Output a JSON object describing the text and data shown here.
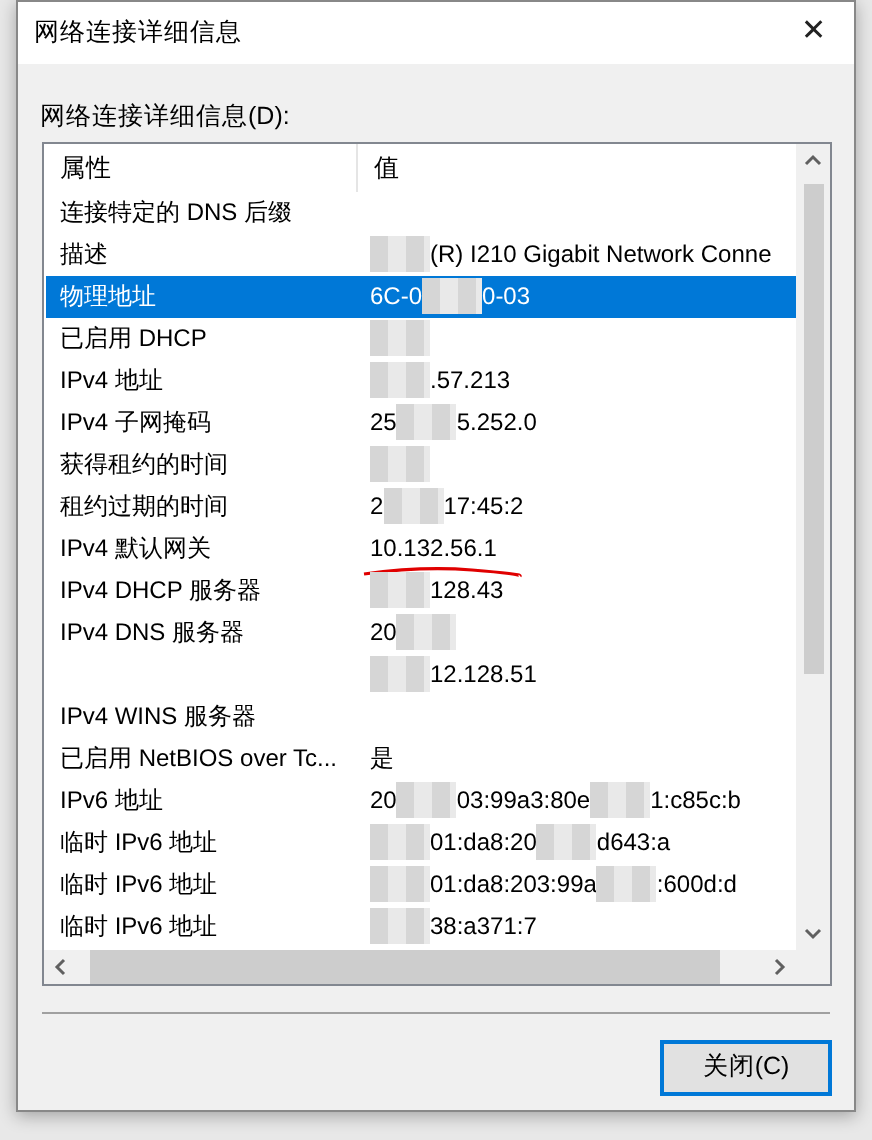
{
  "window": {
    "title": "网络连接详细信息",
    "close_glyph": "✕"
  },
  "list_label": "网络连接详细信息(D):",
  "table": {
    "columns": [
      "属性",
      "值"
    ],
    "rows": [
      {
        "property": "连接特定的 DNS 后缀",
        "selected": false,
        "value": []
      },
      {
        "property": "描述",
        "selected": false,
        "value": [
          {
            "kind": "redacted"
          },
          {
            "kind": "text",
            "text": "(R) I210 Gigabit Network Conne"
          }
        ]
      },
      {
        "property": "物理地址",
        "selected": true,
        "value": [
          {
            "kind": "text",
            "text": "6C-0"
          },
          {
            "kind": "redacted"
          },
          {
            "kind": "text",
            "text": "0-03"
          }
        ]
      },
      {
        "property": "已启用 DHCP",
        "selected": false,
        "value": [
          {
            "kind": "redacted"
          }
        ]
      },
      {
        "property": "IPv4 地址",
        "selected": false,
        "value": [
          {
            "kind": "redacted"
          },
          {
            "kind": "text",
            "text": ".57.213"
          }
        ]
      },
      {
        "property": "IPv4 子网掩码",
        "selected": false,
        "value": [
          {
            "kind": "text",
            "text": "25"
          },
          {
            "kind": "redacted"
          },
          {
            "kind": "text",
            "text": "5.252.0"
          }
        ]
      },
      {
        "property": "获得租约的时间",
        "selected": false,
        "value": [
          {
            "kind": "redacted"
          }
        ]
      },
      {
        "property": "租约过期的时间",
        "selected": false,
        "value": [
          {
            "kind": "text",
            "text": "2"
          },
          {
            "kind": "redacted"
          },
          {
            "kind": "text",
            "text": "17:45:2"
          }
        ]
      },
      {
        "property": "IPv4 默认网关",
        "selected": false,
        "underlined": true,
        "value": [
          {
            "kind": "text",
            "text": "10.132.56.1"
          }
        ]
      },
      {
        "property": "IPv4 DHCP 服务器",
        "selected": false,
        "value": [
          {
            "kind": "redacted"
          },
          {
            "kind": "text",
            "text": "128.43"
          }
        ]
      },
      {
        "property": "IPv4 DNS 服务器",
        "selected": false,
        "value": [
          {
            "kind": "text",
            "text": "20"
          },
          {
            "kind": "redacted"
          }
        ]
      },
      {
        "property": "",
        "selected": false,
        "value": [
          {
            "kind": "redacted"
          },
          {
            "kind": "text",
            "text": "12.128.51"
          }
        ]
      },
      {
        "property": "IPv4 WINS 服务器",
        "selected": false,
        "value": []
      },
      {
        "property": "已启用 NetBIOS over Tc...",
        "selected": false,
        "value": [
          {
            "kind": "text",
            "text": "是"
          }
        ]
      },
      {
        "property": "IPv6 地址",
        "selected": false,
        "value": [
          {
            "kind": "text",
            "text": "20"
          },
          {
            "kind": "redacted"
          },
          {
            "kind": "text",
            "text": "03:99a3:80e"
          },
          {
            "kind": "redacted"
          },
          {
            "kind": "text",
            "text": "1:c85c:b"
          }
        ]
      },
      {
        "property": "临时 IPv6 地址",
        "selected": false,
        "value": [
          {
            "kind": "redacted"
          },
          {
            "kind": "text",
            "text": "01:da8:20"
          },
          {
            "kind": "redacted"
          },
          {
            "kind": "text",
            "text": "d643:a"
          }
        ]
      },
      {
        "property": "临时 IPv6 地址",
        "selected": false,
        "value": [
          {
            "kind": "redacted"
          },
          {
            "kind": "text",
            "text": "01:da8:203:99a"
          },
          {
            "kind": "redacted"
          },
          {
            "kind": "text",
            "text": ":600d:d"
          }
        ]
      },
      {
        "property": "临时 IPv6 地址",
        "selected": false,
        "value": [
          {
            "kind": "redacted"
          },
          {
            "kind": "text",
            "text": "38:a371:7"
          }
        ]
      }
    ]
  },
  "buttons": [
    {
      "label": "关闭(C)",
      "default": true
    }
  ]
}
